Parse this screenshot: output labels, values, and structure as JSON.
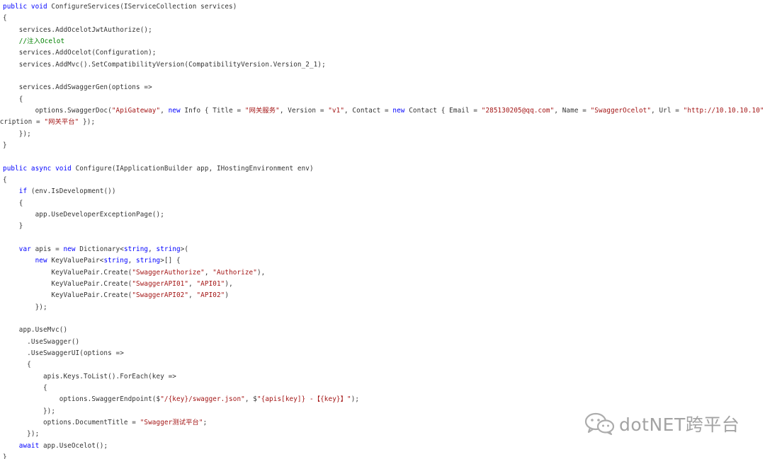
{
  "editor": {
    "lines": [
      [
        [
          "kw",
          "public void "
        ],
        [
          "plain",
          "ConfigureServices(IServiceCollection services)"
        ]
      ],
      [
        [
          "plain",
          "{"
        ]
      ],
      [
        [
          "plain",
          "    services.AddOcelotJwtAuthorize();"
        ]
      ],
      [
        [
          "com",
          "    //注入Ocelot"
        ]
      ],
      [
        [
          "plain",
          "    services.AddOcelot(Configuration);"
        ]
      ],
      [
        [
          "plain",
          "    services.AddMvc().SetCompatibilityVersion(CompatibilityVersion.Version_2_1);"
        ]
      ],
      [
        [
          "plain",
          ""
        ]
      ],
      [
        [
          "plain",
          "    services.AddSwaggerGen(options =>"
        ]
      ],
      [
        [
          "plain",
          "    {"
        ]
      ],
      [
        [
          "plain",
          "        options.SwaggerDoc("
        ],
        [
          "str",
          "\"ApiGateway\""
        ],
        [
          "plain",
          ", "
        ],
        [
          "kw",
          "new "
        ],
        [
          "plain",
          "Info { Title = "
        ],
        [
          "str",
          "\"网关服务\""
        ],
        [
          "plain",
          ", Version = "
        ],
        [
          "str",
          "\"v1\""
        ],
        [
          "plain",
          ", Contact = "
        ],
        [
          "kw",
          "new "
        ],
        [
          "plain",
          "Contact { Email = "
        ],
        [
          "str",
          "\"285130205@qq.com\""
        ],
        [
          "plain",
          ", Name = "
        ],
        [
          "str",
          "\"SwaggerOcelot\""
        ],
        [
          "plain",
          ", Url = "
        ],
        [
          "str",
          "\"http://10.10.10.10\""
        ],
        [
          "plain",
          " },"
        ]
      ],
      [
        [
          "plain",
          "scription = "
        ],
        [
          "str",
          "\"网关平台\""
        ],
        [
          "plain",
          " });"
        ]
      ],
      [
        [
          "plain",
          "    });"
        ]
      ],
      [
        [
          "plain",
          "}"
        ]
      ],
      [
        [
          "plain",
          ""
        ]
      ],
      [
        [
          "kw",
          "public async void "
        ],
        [
          "plain",
          "Configure(IApplicationBuilder app, IHostingEnvironment env)"
        ]
      ],
      [
        [
          "plain",
          "{"
        ]
      ],
      [
        [
          "kw",
          "    if "
        ],
        [
          "plain",
          "(env.IsDevelopment())"
        ]
      ],
      [
        [
          "plain",
          "    {"
        ]
      ],
      [
        [
          "plain",
          "        app.UseDeveloperExceptionPage();"
        ]
      ],
      [
        [
          "plain",
          "    }"
        ]
      ],
      [
        [
          "plain",
          ""
        ]
      ],
      [
        [
          "kw",
          "    var "
        ],
        [
          "plain",
          "apis = "
        ],
        [
          "kw",
          "new "
        ],
        [
          "plain",
          "Dictionary<"
        ],
        [
          "kw",
          "string"
        ],
        [
          "plain",
          ", "
        ],
        [
          "kw",
          "string"
        ],
        [
          "plain",
          ">("
        ]
      ],
      [
        [
          "kw",
          "        new "
        ],
        [
          "plain",
          "KeyValuePair<"
        ],
        [
          "kw",
          "string"
        ],
        [
          "plain",
          ", "
        ],
        [
          "kw",
          "string"
        ],
        [
          "plain",
          ">[] {"
        ]
      ],
      [
        [
          "plain",
          "            KeyValuePair.Create("
        ],
        [
          "str",
          "\"SwaggerAuthorize\""
        ],
        [
          "plain",
          ", "
        ],
        [
          "str",
          "\"Authorize\""
        ],
        [
          "plain",
          "),"
        ]
      ],
      [
        [
          "plain",
          "            KeyValuePair.Create("
        ],
        [
          "str",
          "\"SwaggerAPI01\""
        ],
        [
          "plain",
          ", "
        ],
        [
          "str",
          "\"API01\""
        ],
        [
          "plain",
          "),"
        ]
      ],
      [
        [
          "plain",
          "            KeyValuePair.Create("
        ],
        [
          "str",
          "\"SwaggerAPI02\""
        ],
        [
          "plain",
          ", "
        ],
        [
          "str",
          "\"API02\""
        ],
        [
          "plain",
          ")"
        ]
      ],
      [
        [
          "plain",
          "        });"
        ]
      ],
      [
        [
          "plain",
          ""
        ]
      ],
      [
        [
          "plain",
          "    app.UseMvc()"
        ]
      ],
      [
        [
          "plain",
          "      .UseSwagger()"
        ]
      ],
      [
        [
          "plain",
          "      .UseSwaggerUI(options =>"
        ]
      ],
      [
        [
          "plain",
          "      {"
        ]
      ],
      [
        [
          "plain",
          "          apis.Keys.ToList().ForEach(key =>"
        ]
      ],
      [
        [
          "plain",
          "          {"
        ]
      ],
      [
        [
          "plain",
          "              options.SwaggerEndpoint($"
        ],
        [
          "str",
          "\"/{key}/swagger.json\""
        ],
        [
          "plain",
          ", $"
        ],
        [
          "str",
          "\"{apis[key]} -【{key}】\""
        ],
        [
          "plain",
          ");"
        ]
      ],
      [
        [
          "plain",
          "          });"
        ]
      ],
      [
        [
          "plain",
          "          options.DocumentTitle = "
        ],
        [
          "str",
          "\"Swagger测试平台\""
        ],
        [
          "plain",
          ";"
        ]
      ],
      [
        [
          "plain",
          "      });"
        ]
      ],
      [
        [
          "kw",
          "    await "
        ],
        [
          "plain",
          "app.UseOcelot();"
        ]
      ],
      [
        [
          "plain",
          "}"
        ]
      ]
    ],
    "colors": {
      "keyword": "#0000ff",
      "string": "#a31515",
      "comment": "#008000",
      "plain": "#333333",
      "background": "#ffffff"
    }
  },
  "watermark": {
    "text": "dotNET跨平台",
    "icon": "wechat-icon",
    "color": "#8f8f8f"
  }
}
